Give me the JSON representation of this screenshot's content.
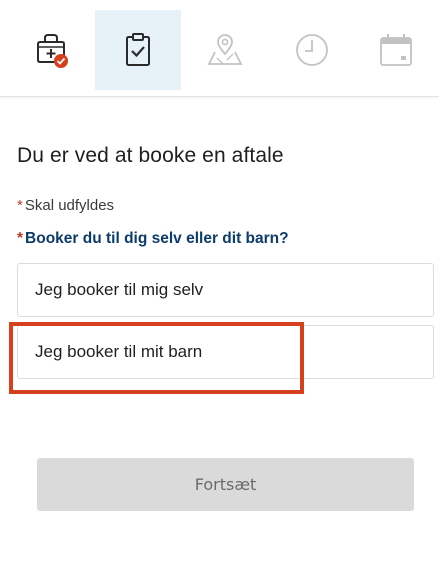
{
  "steps": [
    {
      "icon": "medical-bag-icon",
      "status": "completed"
    },
    {
      "icon": "clipboard-check-icon",
      "status": "active"
    },
    {
      "icon": "map-location-icon",
      "status": "upcoming"
    },
    {
      "icon": "clock-icon",
      "status": "upcoming"
    },
    {
      "icon": "calendar-icon",
      "status": "upcoming"
    }
  ],
  "colors": {
    "active_step_bg": "#e6f1f8",
    "question_label": "#0d3b6a",
    "asterisk": "#c0392b",
    "completed_badge": "#d6401c",
    "highlight_border": "#d6401c",
    "disabled_button_bg": "#dadada"
  },
  "form": {
    "title": "Du er ved at booke en aftale",
    "required_marker": "*",
    "required_note": "Skal udfyldes",
    "question": "Booker du til dig selv eller dit barn?",
    "options": [
      {
        "label": "Jeg booker til mig selv"
      },
      {
        "label": "Jeg booker til mit barn",
        "highlighted": true
      }
    ],
    "continue_label": "Fortsæt",
    "continue_disabled": true
  }
}
